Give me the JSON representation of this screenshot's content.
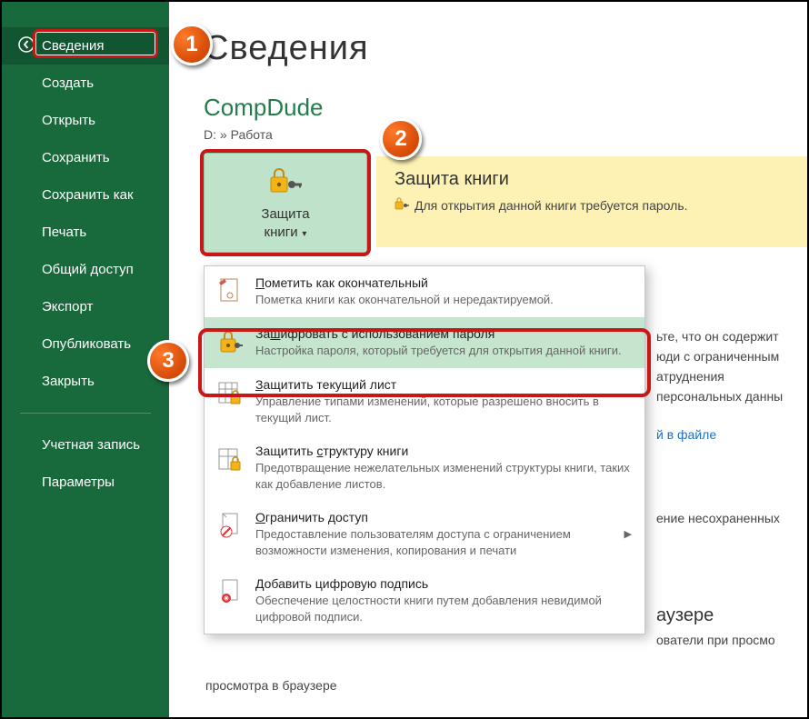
{
  "sidebar": {
    "items": [
      {
        "label": "Сведения",
        "selected": true
      },
      {
        "label": "Создать"
      },
      {
        "label": "Открыть"
      },
      {
        "label": "Сохранить"
      },
      {
        "label": "Сохранить как"
      },
      {
        "label": "Печать"
      },
      {
        "label": "Общий доступ"
      },
      {
        "label": "Экспорт"
      },
      {
        "label": "Опубликовать"
      },
      {
        "label": "Закрыть"
      }
    ],
    "footer": [
      {
        "label": "Учетная запись"
      },
      {
        "label": "Параметры"
      }
    ]
  },
  "main": {
    "title": "Сведения",
    "doc_name": "CompDude",
    "doc_path": "D: » Работа",
    "protect_btn_l1": "Защита",
    "protect_btn_l2": "книги",
    "info_title": "Защита книги",
    "info_msg": "Для открытия данной книги требуется пароль."
  },
  "dropdown": {
    "items": [
      {
        "title": "Пометить как окончательный",
        "ukey": "П",
        "desc": "Пометка книги как окончательной и нередактируемой."
      },
      {
        "title": "Зашифровать с использованием пароля",
        "ukey": "ш",
        "desc": "Настройка пароля, который требуется для открытия данной книги."
      },
      {
        "title": "Защитить текущий лист",
        "ukey": "З",
        "desc": "Управление типами изменений, которые разрешено вносить в текущий лист."
      },
      {
        "title": "Защитить структуру книги",
        "ukey": "с",
        "desc": "Предотвращение нежелательных изменений структуры книги, таких как добавление листов."
      },
      {
        "title": "Ограничить доступ",
        "ukey": "О",
        "desc": "Предоставление пользователям доступа с ограничением возможности изменения, копирования и печати",
        "chev": true
      },
      {
        "title": "Добавить цифровую подпись",
        "ukey": "Д",
        "desc": "Обеспечение целостности книги путем добавления невидимой цифровой подписи."
      }
    ]
  },
  "bg": {
    "a1": "ьте, что он содержит",
    "a2": "юди с ограниченным",
    "a3": "атруднения",
    "a4": "персональных данны",
    "link1": "й в файле",
    "b1": "ение несохраненных",
    "c1": "аузере",
    "c2": "ователи при просмо",
    "c3": "просмотра в браузере"
  },
  "badges": {
    "n1": "1",
    "n2": "2",
    "n3": "3"
  },
  "colors": {
    "brand": "#18693b",
    "accent": "#c91616"
  }
}
